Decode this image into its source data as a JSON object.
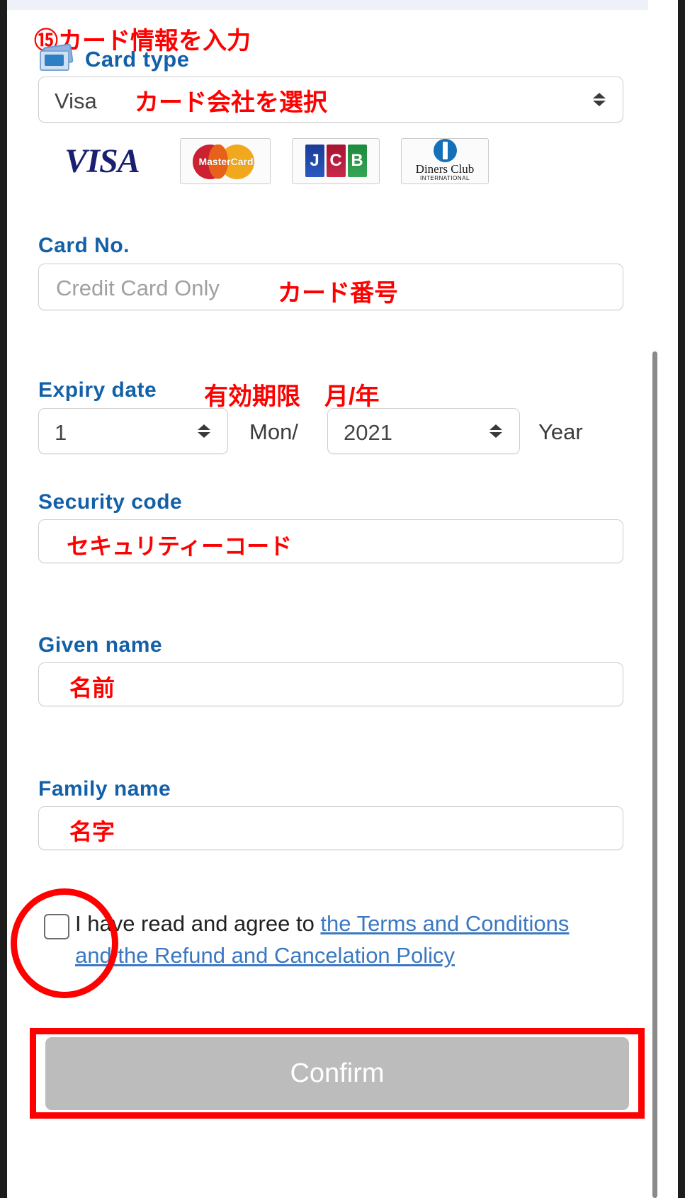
{
  "annotations": {
    "step_note": "⑮カード情報を入力",
    "card_company_select": "カード会社を選択",
    "card_number": "カード番号",
    "expiry": "有効期限　月/年",
    "security_code": "セキュリティーコード",
    "given_name": "名前",
    "family_name": "名字"
  },
  "form": {
    "card_type": {
      "label": "Card type",
      "icon": "card-stack-icon",
      "selected": "Visa",
      "options": [
        "Visa",
        "MasterCard",
        "JCB",
        "Diners Club"
      ]
    },
    "accepted_logos": [
      {
        "name": "visa-logo",
        "text": "VISA"
      },
      {
        "name": "mastercard-logo",
        "text": "MasterCard"
      },
      {
        "name": "jcb-logo",
        "letters": [
          "J",
          "C",
          "B"
        ]
      },
      {
        "name": "diners-club-logo",
        "line1": "Diners Club",
        "line2": "INTERNATIONAL"
      }
    ],
    "card_no": {
      "label": "Card No.",
      "placeholder": "Credit Card Only",
      "value": ""
    },
    "expiry_date": {
      "label": "Expiry date",
      "month_value": "1",
      "month_suffix": "Mon/",
      "year_value": "2021",
      "year_suffix": "Year"
    },
    "security_code": {
      "label": "Security code",
      "value": ""
    },
    "given_name": {
      "label": "Given name",
      "value": ""
    },
    "family_name": {
      "label": "Family name",
      "value": ""
    },
    "terms": {
      "prefix": "I have read and agree to ",
      "link": "the Terms and Conditions and the Refund and Cancelation Policy",
      "checked": false
    },
    "confirm_button": "Confirm"
  },
  "colors": {
    "label_blue": "#1360a8",
    "annotation_red": "#ff0000",
    "link_blue": "#3b78c2",
    "confirm_grey": "#bcbcbc",
    "top_strip": "#eef1f7"
  }
}
